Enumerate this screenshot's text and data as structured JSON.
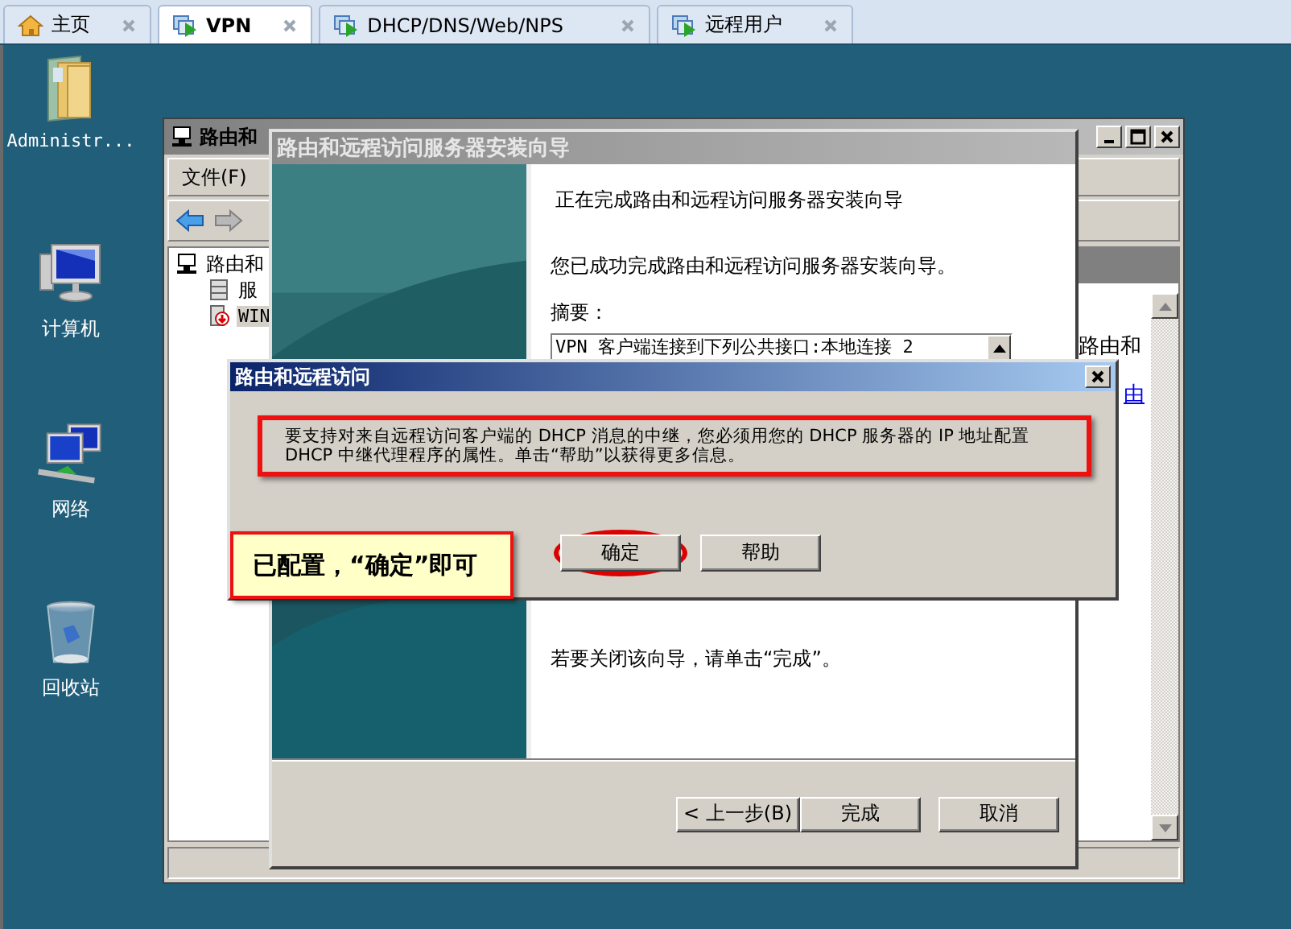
{
  "tabs": [
    {
      "label": "主页",
      "kind": "home",
      "selected": false
    },
    {
      "label": "VPN",
      "kind": "vm",
      "selected": true
    },
    {
      "label": "DHCP/DNS/Web/NPS",
      "kind": "vm",
      "selected": false
    },
    {
      "label": "远程用户",
      "kind": "vm",
      "selected": false
    }
  ],
  "desktop_icons": [
    {
      "label": "Administr...",
      "kind": "folder"
    },
    {
      "label": "计算机",
      "kind": "computer"
    },
    {
      "label": "网络",
      "kind": "network"
    },
    {
      "label": "回收站",
      "kind": "recycle"
    }
  ],
  "mmc_window": {
    "title": "路由和",
    "menu": [
      "文件(F)"
    ],
    "tree": [
      {
        "label": "路由和",
        "kind": "root",
        "selected": false,
        "children": [
          {
            "label": "服",
            "kind": "server",
            "selected": false
          },
          {
            "label": "WIN",
            "kind": "server-status",
            "selected": true
          }
        ]
      }
    ],
    "content_text": "路由和",
    "content_link": "由"
  },
  "wizard": {
    "title": "路由和远程访问服务器安装向导",
    "heading": "正在完成路由和远程访问服务器安装向导",
    "intro": "您已成功完成路由和远程访问服务器安装向导。",
    "summary_label": "摘要：",
    "summary_lines": [
      "VPN 客户端连接到下列公共接口:本地连接 2"
    ],
    "closing": "若要关闭该向导，请单击“完成”。",
    "buttons": [
      "< 上一步(B)",
      "完成",
      "取消"
    ]
  },
  "dialog": {
    "title": "路由和远程访问",
    "message": "要支持对来自远程访问客户端的 DHCP 消息的中继，您必须用您的 DHCP 服务器的 IP 地址配置 DHCP 中继代理程序的属性。单击“帮助”以获得更多信息。",
    "message_highlighted": true,
    "buttons": [
      {
        "label": "确定",
        "circled": true
      },
      {
        "label": "帮助",
        "circled": false
      }
    ]
  },
  "annotation": {
    "text": "已配置，“确定”即可"
  }
}
